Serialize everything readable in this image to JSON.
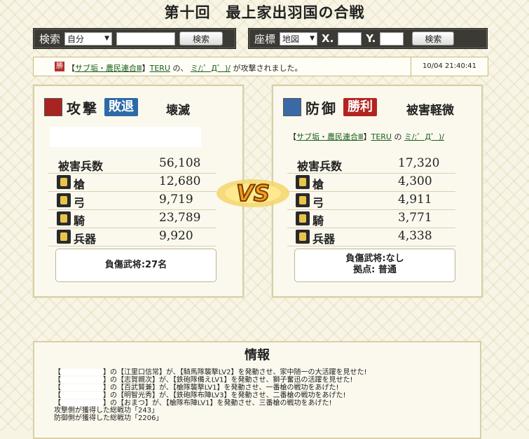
{
  "page": {
    "title": "第十回　最上家出羽国の合戦"
  },
  "search_bar": {
    "label": "検索",
    "select_value": "自分",
    "input_value": "",
    "button": "検索"
  },
  "coord_bar": {
    "label": "座標",
    "select_value": "地図",
    "x_label": "X.",
    "y_label": "Y.",
    "x_value": "",
    "y_value": "",
    "button": "検索"
  },
  "notice": {
    "badge": "勝",
    "alliance": "サブ垢・農民連合Ⅲ",
    "player": "TERU",
    "mid1": "の、",
    "target": "ミ/;゜Д゜)/",
    "tail": "が攻撃されました。",
    "timestamp": "10/04 21:40:41"
  },
  "attack": {
    "type": "攻撃",
    "result": "敗退",
    "damage": "壊滅",
    "total_label": "被害兵数",
    "total": "56,108",
    "rows": [
      {
        "label": "槍",
        "value": "12,680"
      },
      {
        "label": "弓",
        "value": "9,719"
      },
      {
        "label": "騎",
        "value": "23,789"
      },
      {
        "label": "兵器",
        "value": "9,920"
      }
    ],
    "injured": "負傷武将:27名"
  },
  "defense": {
    "type": "防御",
    "result": "勝利",
    "damage": "被害軽微",
    "alliance": "サブ垢・農民連合Ⅲ",
    "player": "TERU",
    "conn": "の",
    "target": "ミ/;゜Д゜)/",
    "total_label": "被害兵数",
    "total": "17,320",
    "rows": [
      {
        "label": "槍",
        "value": "4,300"
      },
      {
        "label": "弓",
        "value": "4,911"
      },
      {
        "label": "騎",
        "value": "3,771"
      },
      {
        "label": "兵器",
        "value": "4,338"
      }
    ],
    "injured": "負傷武将:なし",
    "base": "拠点: 普通"
  },
  "vs": {
    "text": "VS"
  },
  "info": {
    "heading": "情報",
    "lines": [
      "の【江里口信常】が、【騎馬隊襲撃LV2】を発動させ、家中随一の大活躍を見せた!",
      "の【志賀親次】が、【鉄砲隊備えLV1】を発動させ、獅子奮迅の活躍を見せた!",
      "の【百武賢兼】が、【槍隊襲撃LV1】を発動させ、一番槍の戦功をあげた!",
      "の【明智光秀】が、【鉄砲隊布陣LV3】を発動させ、二番槍の戦功をあげた!",
      "の【おまつ】が、【槍隊布陣LV1】を発動させ、三番槍の戦功をあげた!"
    ],
    "attack_merit": "攻撃側が獲得した総戦功「243」",
    "defense_merit": "防御側が獲得した総戦功「2206」"
  }
}
